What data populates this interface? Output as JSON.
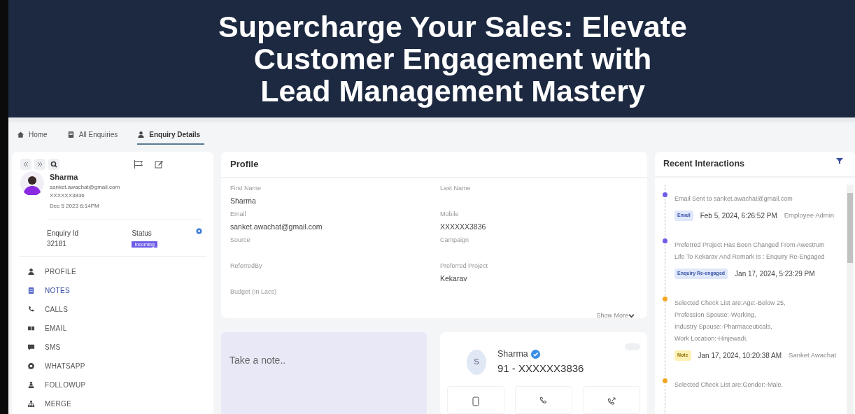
{
  "banner": {
    "title_lines": [
      "Supercharge Your Sales: Elevate",
      "Customer Engagement with",
      "Lead Management Mastery"
    ]
  },
  "breadcrumbs": [
    {
      "label": "Home",
      "selected": false
    },
    {
      "label": "All Enquiries",
      "selected": false
    },
    {
      "label": "Enquiry Details",
      "selected": true
    }
  ],
  "lead_card": {
    "name": "Sharma",
    "email": "sanket.awachat@gmail.com",
    "phone": "XXXXXX3836",
    "date": "Dec 5 2023 6:14PM",
    "enquiry_id_label": "Enquiry Id",
    "enquiry_id": "32181",
    "status_label": "Status",
    "status": "Incoming",
    "nav": [
      {
        "label": "PROFILE",
        "selected": false
      },
      {
        "label": "NOTES",
        "selected": true
      },
      {
        "label": "CALLS",
        "selected": false
      },
      {
        "label": "EMAIL",
        "selected": false
      },
      {
        "label": "SMS",
        "selected": false
      },
      {
        "label": "WHATSAPP",
        "selected": false
      },
      {
        "label": "FOLLOWUP",
        "selected": false
      },
      {
        "label": "MERGE",
        "selected": false
      }
    ]
  },
  "profile": {
    "title": "Profile",
    "fields": [
      {
        "label": "First Name",
        "value": "Sharma"
      },
      {
        "label": "Last Name"
      },
      {
        "label": "Email",
        "value": "sanket.awachat@gmail.com"
      },
      {
        "label": "Mobile",
        "value": "XXXXXX3836"
      },
      {
        "label": "Source"
      },
      {
        "label": "Campaign"
      },
      {
        "label": "ReferredBy"
      },
      {
        "label": "Preferred Project",
        "value": "Kekarav"
      },
      {
        "label": "Budget (In Lacs)"
      }
    ],
    "show_more": "Show More"
  },
  "note": {
    "placeholder": "Take a note.."
  },
  "contact": {
    "initial": "S",
    "name": "Sharma",
    "verified": true,
    "phone": "91 - XXXXXX3836",
    "toggle_on": false
  },
  "recent_interactions": {
    "title": "Recent Interactions",
    "items": [
      {
        "color": "#6c5ce7",
        "text": "Email Sent to sanket.awachat@gmail.com",
        "tag": "Email",
        "kind": "email",
        "date": "Feb 5, 2024, 6:26:52 PM",
        "author": "Employee Admin"
      },
      {
        "color": "#6c5ce7",
        "text": "Preferred Project Has Been Changed From Awestrum Life To Kekarav And Remark Is : Enquiry Re-Engaged",
        "tag": "Enquiry Re-engaged",
        "kind": "info",
        "date": "Jan 17, 2024, 5:23:29 PM"
      },
      {
        "color": "#f5a623",
        "text": "Selected Check List are:Age:-Below 25,\nProfession Spouse:-Working,\nIndustry Spouse:-Pharmaceuticals,\nWork Location:-Hinjewadi,",
        "tag": "Note",
        "kind": "note",
        "date": "Jan 17, 2024, 10:20:38 AM",
        "author": "Sanket Awachat"
      },
      {
        "color": "#f5a623",
        "text": "Selected Check List are:Gender:-Male."
      }
    ]
  }
}
